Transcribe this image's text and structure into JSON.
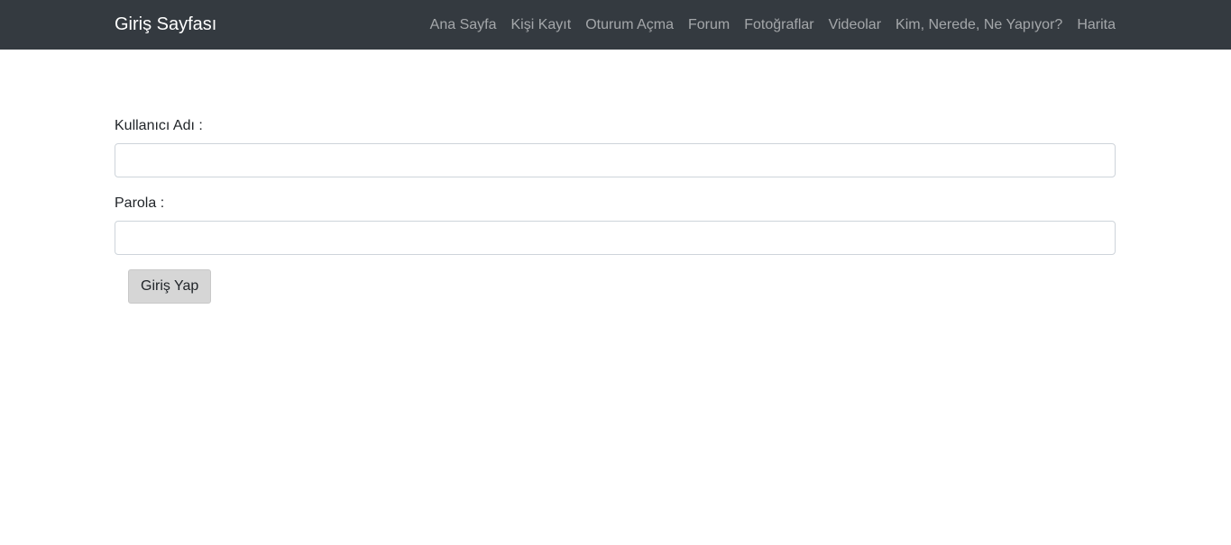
{
  "navbar": {
    "brand": "Giriş Sayfası",
    "items": [
      {
        "label": "Ana Sayfa"
      },
      {
        "label": "Kişi Kayıt"
      },
      {
        "label": "Oturum Açma"
      },
      {
        "label": "Forum"
      },
      {
        "label": "Fotoğraflar"
      },
      {
        "label": "Videolar"
      },
      {
        "label": "Kim, Nerede, Ne Yapıyor?"
      },
      {
        "label": "Harita"
      }
    ],
    "background_color": "#343a40"
  },
  "login_form": {
    "username_label": "Kullanıcı Adı :",
    "username_value": "",
    "password_label": "Parola :",
    "password_value": "",
    "submit_label": "Giriş Yap"
  }
}
